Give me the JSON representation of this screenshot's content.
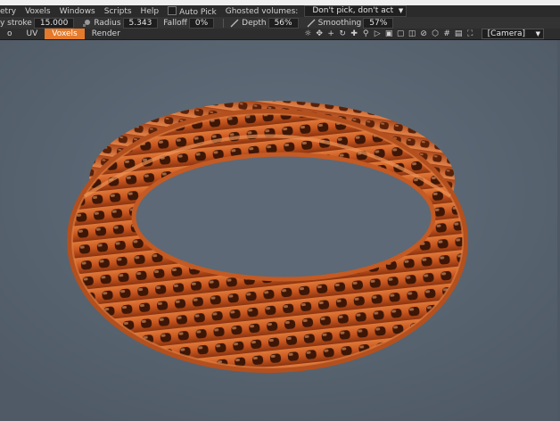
{
  "menubar": {
    "items": [
      "etry",
      "Voxels",
      "Windows",
      "Scripts",
      "Help"
    ],
    "autopick_label": "Auto Pick",
    "ghosted_label": "Ghosted volumes:",
    "ghosted_value": "Don't pick, don't act"
  },
  "toolbar": {
    "stroke_label": "y stroke",
    "stroke_value": "15.000",
    "radius_label": "Radius",
    "radius_value": "5.343",
    "falloff_label": "Falloff",
    "falloff_value": "0%",
    "depth_label": "Depth",
    "depth_value": "56%",
    "smoothing_label": "Smoothing",
    "smoothing_value": "57%"
  },
  "tabs": [
    {
      "label": "o",
      "active": false
    },
    {
      "label": "UV",
      "active": false
    },
    {
      "label": "Voxels",
      "active": true
    },
    {
      "label": "Render",
      "active": false
    }
  ],
  "viewport": {
    "camera_value": "[Camera]",
    "tool_icons": [
      "sun-icon",
      "move-icon",
      "rotate-icon",
      "zoom-icon",
      "play-icon",
      "frame-icon",
      "frame-all-icon",
      "wireframe-icon",
      "no-icon",
      "cube-icon",
      "grid-icon",
      "view-icon",
      "fullscreen-icon"
    ]
  },
  "colors": {
    "accent": "#e47a2b",
    "viewport_bg": "#5b6774",
    "model": "#d2632a"
  }
}
